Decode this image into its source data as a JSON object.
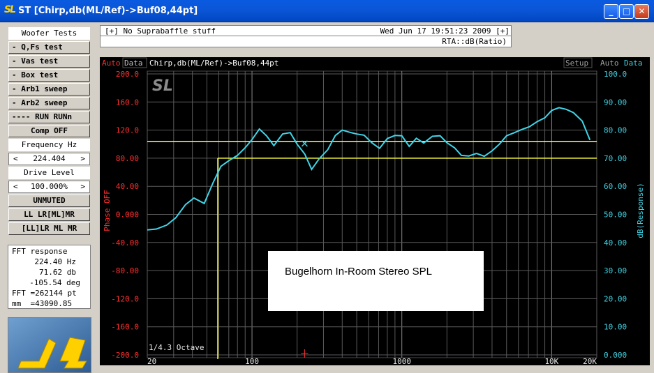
{
  "window": {
    "icon_text": "SL",
    "title": "ST [Chirp,db(ML/Ref)->Buf08,44pt]",
    "minimize": "_",
    "maximize": "□",
    "close": "✕"
  },
  "left_panel": {
    "woofer_tests": "Woofer Tests",
    "buttons": [
      "- Q,Fs test",
      "- Vas test",
      "- Box test",
      "- Arb1 sweep",
      "- Arb2 sweep",
      "---- RUN RUNn"
    ],
    "comp": "Comp OFF",
    "frequency_label": "Frequency Hz",
    "frequency_value": "224.404",
    "drive_label": "Drive Level",
    "drive_value": "100.000%",
    "arrow_left": "<",
    "arrow_right": ">",
    "unmuted": "UNMUTED",
    "channel1": "LL LR[ML]MR",
    "channel2": "[LL]LR ML MR"
  },
  "fft": {
    "title": "FFT response",
    "hz": "224.40 Hz",
    "db": "71.62 db",
    "deg": "-105.54 deg",
    "pt": "FFT =262144 pt",
    "mm": "mm  =43090.85"
  },
  "logo_text": "SL",
  "header": {
    "left": "[+] No Suprabaffle stuff",
    "datetime": "Wed Jun 17 19:51:23 2009 [+]",
    "rta": "RTA::dB(Ratio)"
  },
  "plot": {
    "tag_auto_left": "Auto",
    "tag_data_left": "Data",
    "title": "Chirp,db(ML/Ref)->Buf08,44pt",
    "tag_setup": "Setup",
    "tag_auto_right": "Auto",
    "tag_data_right": "Data",
    "watermark": "SL",
    "octave": "1/4.3 Octave",
    "annotation": "Bugelhorn In-Room Stereo SPL",
    "colors": {
      "trace": "#3fd5e8",
      "cursor": "#ffff40",
      "left_axis": "#ff3030",
      "right_axis": "#40d0e0",
      "grid": "#5a5a5a"
    }
  },
  "chart_data": {
    "type": "line",
    "title": "Chirp,db(ML/Ref)->Buf08,44pt",
    "xlabel": "",
    "ylabel_left": "Phase OFF",
    "ylabel_right": "dB(Response)",
    "x_scale": "log",
    "xlim": [
      20,
      20000
    ],
    "x_ticks": [
      {
        "v": 20,
        "label": "20"
      },
      {
        "v": 100,
        "label": "100"
      },
      {
        "v": 1000,
        "label": "1000"
      },
      {
        "v": 10000,
        "label": "10K"
      },
      {
        "v": 20000,
        "label": "20K"
      }
    ],
    "y_left_lim": [
      -200,
      200
    ],
    "y_left_ticks": [
      "200.0",
      "160.0",
      "120.0",
      "80.00",
      "40.00",
      "0.000",
      "-40.00",
      "-80.00",
      "-120.0",
      "-160.0",
      "-200.0"
    ],
    "y_right_lim": [
      0,
      100
    ],
    "y_right_ticks": [
      "100.0",
      "90.00",
      "80.00",
      "70.00",
      "60.00",
      "50.00",
      "40.00",
      "30.00",
      "20.00",
      "10.00",
      "0.000"
    ],
    "grid": true,
    "series": [
      {
        "values_axis": "right",
        "x": [
          20,
          23,
          27,
          31,
          36,
          41,
          48,
          55,
          62,
          70,
          80,
          90,
          100,
          112,
          125,
          140,
          160,
          180,
          200,
          225,
          250,
          280,
          320,
          360,
          400,
          450,
          500,
          560,
          630,
          710,
          800,
          900,
          1000,
          1120,
          1250,
          1400,
          1600,
          1800,
          2000,
          2250,
          2500,
          2800,
          3150,
          3550,
          4000,
          4500,
          5000,
          5600,
          6300,
          7100,
          8000,
          9000,
          10000,
          11200,
          12500,
          14000,
          16000,
          18000
        ],
        "y": [
          44.5,
          44.8,
          46.2,
          48.8,
          53.5,
          55.8,
          53.9,
          61.3,
          67.1,
          69.1,
          71.0,
          73.7,
          76.6,
          80.4,
          78.0,
          74.5,
          78.6,
          79.1,
          75.0,
          71.5,
          66.0,
          69.7,
          73.0,
          78.1,
          80.0,
          79.2,
          78.6,
          78.2,
          75.5,
          73.5,
          77.0,
          78.1,
          78.0,
          74.2,
          77.1,
          75.4,
          77.8,
          78.0,
          75.5,
          73.7,
          71.0,
          70.8,
          71.7,
          70.7,
          72.6,
          75.1,
          78.0,
          79.0,
          80.2,
          81.2,
          83.0,
          84.4,
          87.0,
          88.0,
          87.4,
          86.2,
          83.2,
          76.5
        ]
      }
    ],
    "cursor": {
      "x_hz": 224.404,
      "db": 71.62
    },
    "reference_lines_db": [
      76.0,
      70.0
    ]
  }
}
